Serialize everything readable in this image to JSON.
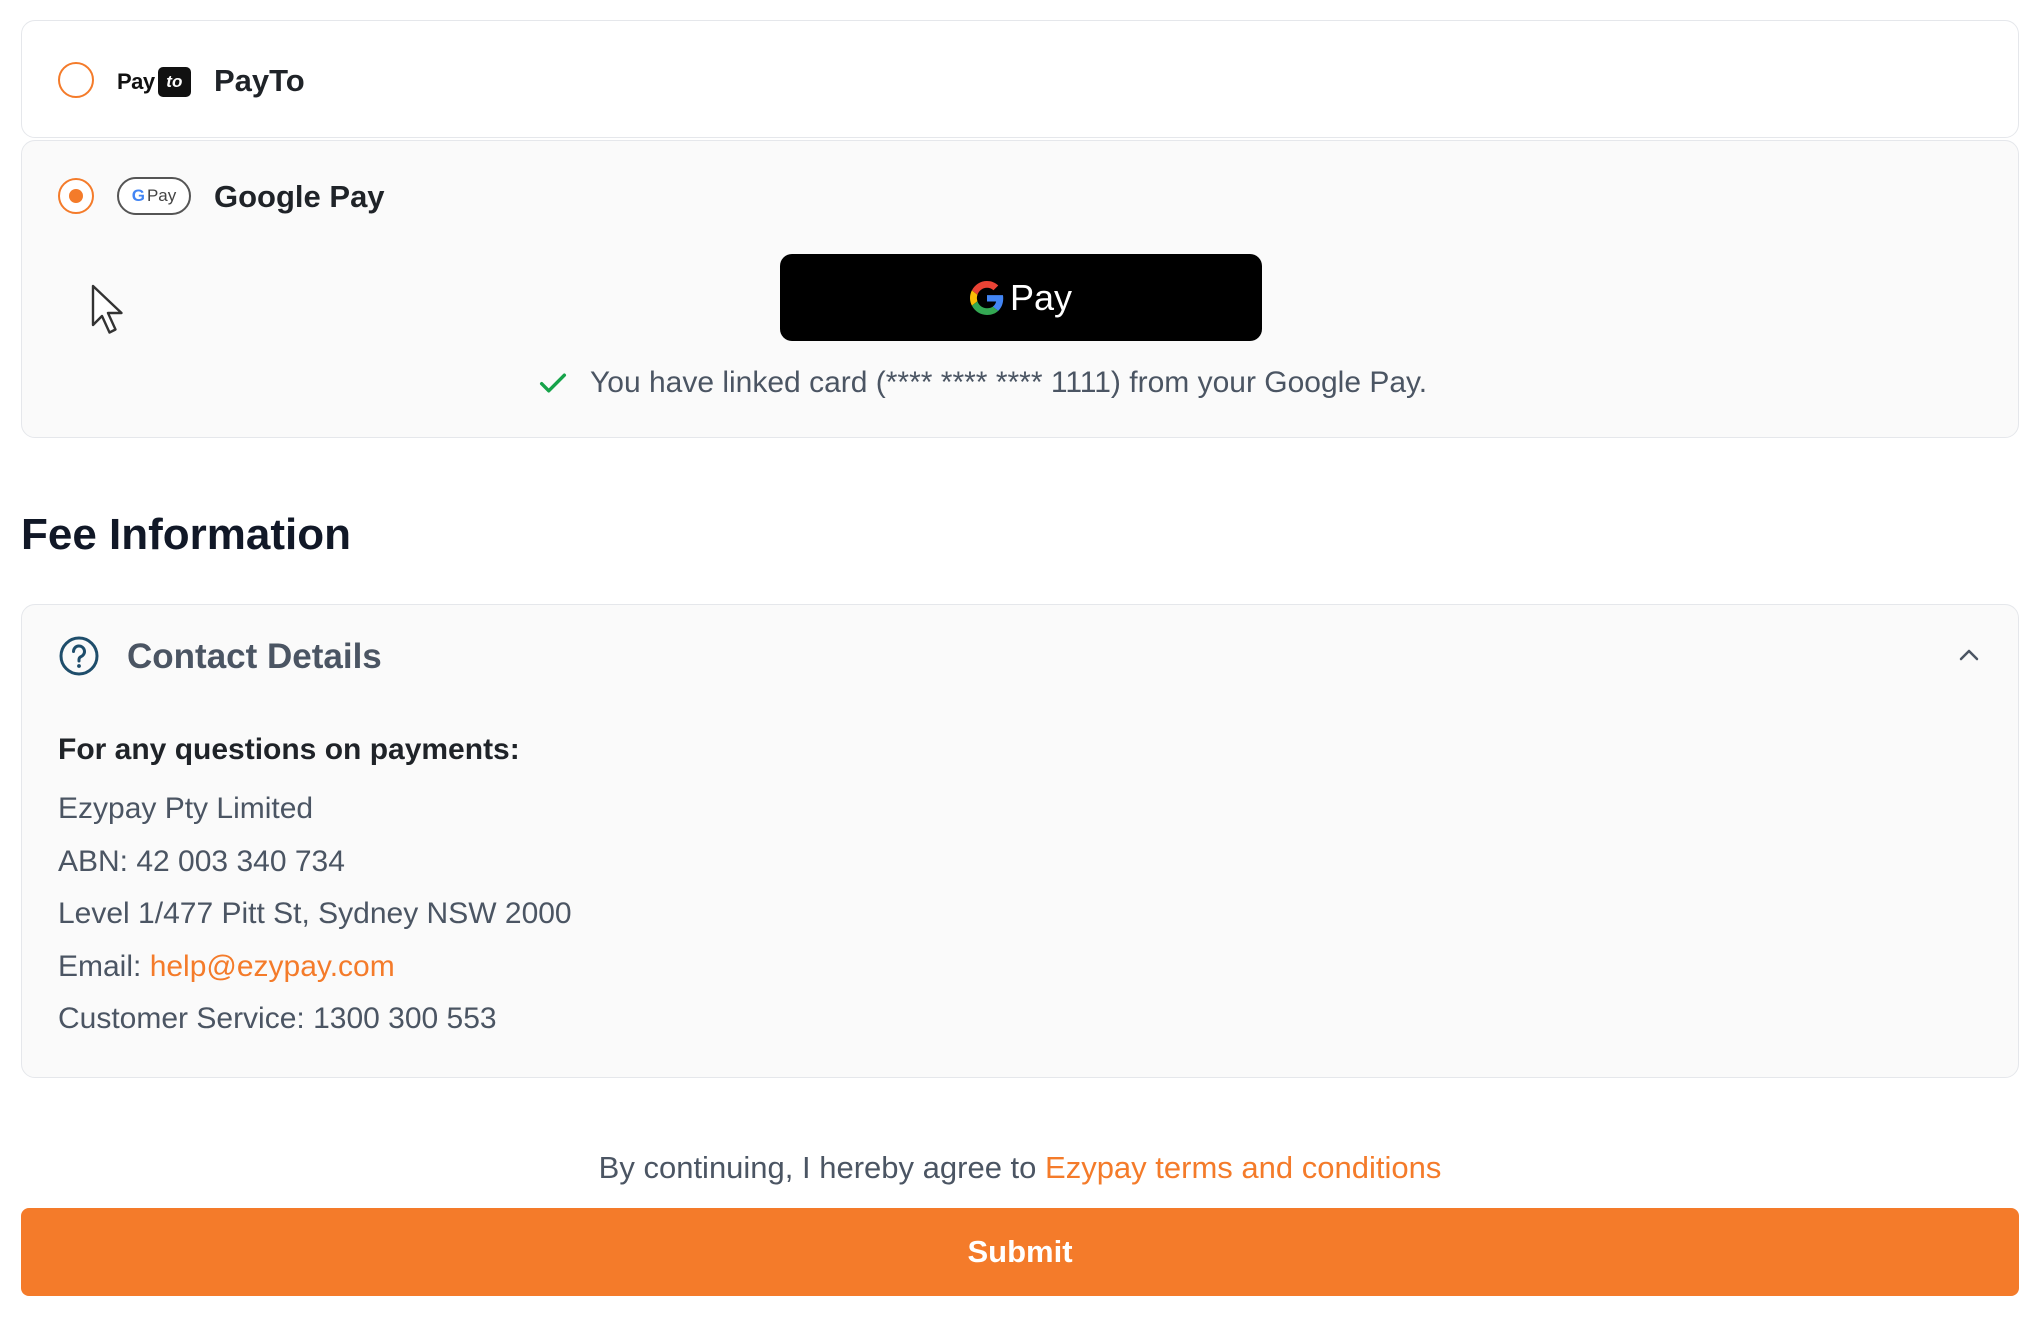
{
  "payment_methods": [
    {
      "label": "PayTo",
      "selected": false,
      "logo": {
        "pay_text": "Pay",
        "to_text": "to"
      }
    },
    {
      "label": "Google Pay",
      "selected": true,
      "logo": {
        "g_text": "G",
        "pay_text": "Pay"
      }
    }
  ],
  "google_pay": {
    "button_label": "Pay",
    "linked_message": "You have linked card (**** **** **** 1111) from your Google Pay."
  },
  "fee_section": {
    "title": "Fee Information"
  },
  "contact": {
    "title": "Contact Details",
    "question": "For any questions on payments:",
    "company": "Ezypay Pty Limited",
    "abn": "ABN: 42 003 340 734",
    "address": "Level 1/477 Pitt St, Sydney NSW 2000",
    "email_prefix": "Email: ",
    "email": "help@ezypay.com",
    "customer_service": "Customer Service: 1300 300 553"
  },
  "footer": {
    "terms_prefix": "By continuing, I hereby agree to ",
    "terms_link": "Ezypay terms and conditions",
    "submit_label": "Submit"
  },
  "colors": {
    "accent": "#f47b2a",
    "success": "#16a34a",
    "text_primary": "#1f2328",
    "text_secondary": "#4b5563",
    "card_border": "#e5e7eb",
    "card_bg": "#fafafa"
  },
  "icons": {
    "linked": "check-icon",
    "contact": "help-circle-icon",
    "collapse": "chevron-up-icon",
    "pointer": "mouse-cursor-icon"
  }
}
